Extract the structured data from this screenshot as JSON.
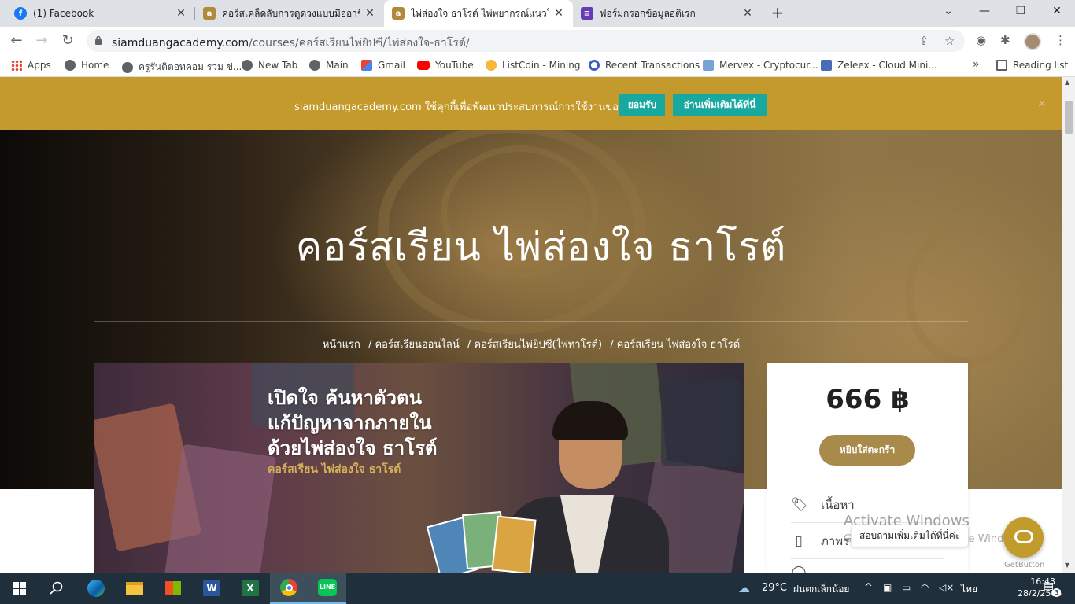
{
  "tabs": [
    {
      "title": "(1) Facebook",
      "icon": "facebook-icon",
      "color": "#1877f2",
      "glyph": "f"
    },
    {
      "title": "คอร์สเคล็ดลับการดูดวงแบบมืออาชีพ - ",
      "icon": "siamduang-icon",
      "color": "#b08a3a",
      "glyph": "a"
    },
    {
      "title": "ไพ่ส่องใจ ธาโรต์ ไพ่พยากรณ์แนวใหม่เ",
      "icon": "siamduang-icon",
      "color": "#b08a3a",
      "glyph": "a"
    },
    {
      "title": "ฟอร์มกรอกข้อมูลอติเรก",
      "icon": "forms-icon",
      "color": "#673ab7",
      "glyph": "≡"
    }
  ],
  "address": {
    "domain": "siamduangacademy.com",
    "path": "/courses/คอร์สเรียนไพ่ยิปซี/ไพ่ส่องใจ-ธาโรต์/"
  },
  "bookmarks": [
    {
      "label": "Apps",
      "icon": "apps-grid-icon"
    },
    {
      "label": "Home",
      "icon": "globe-icon"
    },
    {
      "label": "ครูรันดิตอทคอม รวม ข่...",
      "icon": "globe-icon"
    },
    {
      "label": "New Tab",
      "icon": "globe-icon"
    },
    {
      "label": "Main",
      "icon": "globe-icon"
    },
    {
      "label": "Gmail",
      "icon": "gmail-icon"
    },
    {
      "label": "YouTube",
      "icon": "youtube-icon"
    },
    {
      "label": "ListCoin - Mining",
      "icon": "listcoin-icon"
    },
    {
      "label": "Recent Transactions",
      "icon": "recent-transactions-icon"
    },
    {
      "label": "Mervex - Cryptocur...",
      "icon": "mervex-icon"
    },
    {
      "label": "Zeleex - Cloud Mini...",
      "icon": "zeleex-icon"
    }
  ],
  "bookmarks_more": "»",
  "reading_list": "Reading list",
  "cookie": {
    "text": "siamduangacademy.com ใช้คุกกี้เพื่อพัฒนาประสบการณ์การใช้งานของคุณ",
    "accept": "ยอมรับ",
    "more": "อ่านเพิ่มเติมได้ที่นี่",
    "close": "×"
  },
  "hero": {
    "title": "คอร์สเรียน ไพ่ส่องใจ ธาโรต์",
    "breadcrumbs": [
      "หน้าแรก",
      "/ คอร์สเรียนออนไลน์",
      "/ คอร์สเรียนไพ่ยิปซี(ไพ่ทาโรต์)",
      "/ คอร์สเรียน ไพ่ส่องใจ ธาโรต์"
    ]
  },
  "banner": {
    "line1": "เปิดใจ ค้นหาตัวตน",
    "line2": "แก้ปัญหาจากภายใน",
    "line3": "ด้วยไพ่ส่องใจ ธาโรต์",
    "sub": "คอร์สเรียน ไพ่ส่องใจ ธาโรต์"
  },
  "pricebox": {
    "price": "666 ฿",
    "cart_button": "หยิบใส่ตะกร้า",
    "items": [
      {
        "label": "เนื้อหา",
        "icon": "tag-icon"
      },
      {
        "label": "ภาพร",
        "icon": "document-icon"
      }
    ]
  },
  "watermark": {
    "line1": "Activate Windows",
    "line2": "Go to Settings to activate Windows."
  },
  "chat": {
    "bubble": "สอบถามเพิ่มเติมได้ที่นี่ค่ะ",
    "powered": "GetButton"
  },
  "taskbar": {
    "temperature": "29°C",
    "weather": "ฝนตกเล็กน้อย",
    "lang": "ไทย",
    "time": "16:43",
    "date": "28/2/2565",
    "notifications": "3"
  }
}
